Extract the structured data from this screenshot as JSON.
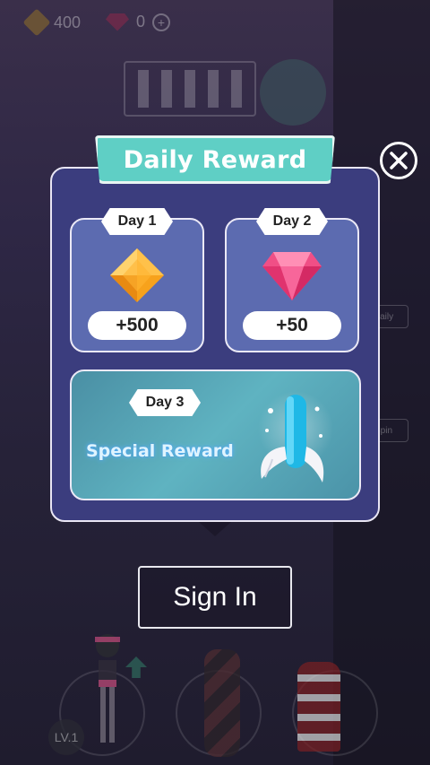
{
  "hud": {
    "gold_amount": "400",
    "gem_amount": "0",
    "plus_symbol": "+"
  },
  "background": {
    "side_buttons": [
      "Daily",
      "Spin"
    ],
    "level_badge": "LV.1"
  },
  "dialog": {
    "title": "Daily Reward",
    "rewards": [
      {
        "day": "Day 1",
        "amount": "+500",
        "icon": "gold-gem-icon",
        "color": "#f5a623"
      },
      {
        "day": "Day 2",
        "amount": "+50",
        "icon": "pink-diamond-icon",
        "color": "#f04f86"
      }
    ],
    "special": {
      "day": "Day 3",
      "label": "Special Reward",
      "icon": "winged-board-icon"
    },
    "close_icon": "close-icon"
  },
  "sign_in_button": "Sign In",
  "colors": {
    "banner": "#5fcfc5",
    "dialog_bg": "#3b3d7e",
    "card_bg": "#5c6bb0",
    "special_bg": "#5fb3c1"
  }
}
